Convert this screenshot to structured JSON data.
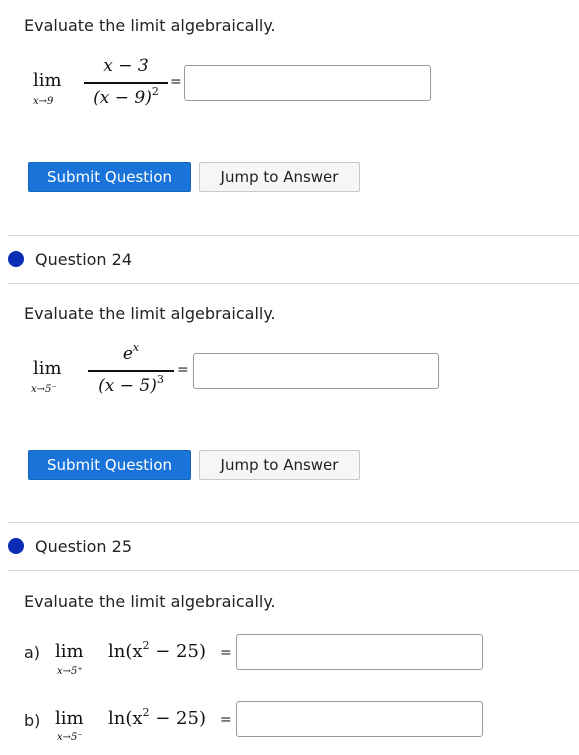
{
  "q23": {
    "prompt": "Evaluate the limit algebraically.",
    "lim": "lim",
    "sub": "x→9",
    "num": "x − 3",
    "den_base": "(x − 9)",
    "den_exp": "2",
    "equals": "=",
    "answer_value": "",
    "submit_label": "Submit Question",
    "jump_label": "Jump to Answer"
  },
  "q24": {
    "title": "Question 24",
    "prompt": "Evaluate the limit algebraically.",
    "lim": "lim",
    "sub": "x→5⁻",
    "num_base": "e",
    "num_exp": "x",
    "den_base": "(x − 5)",
    "den_exp": "3",
    "equals": "=",
    "answer_value": "",
    "submit_label": "Submit Question",
    "jump_label": "Jump to Answer"
  },
  "q25": {
    "title": "Question 25",
    "prompt": "Evaluate the limit algebraically.",
    "parts": [
      {
        "label": "a)",
        "lim": "lim",
        "sub": "x→5⁺",
        "expr": "ln(x",
        "exp": "2",
        "expr_tail": " − 25)",
        "equals": "=",
        "answer_value": ""
      },
      {
        "label": "b)",
        "lim": "lim",
        "sub": "x→5⁻",
        "expr": "ln(x",
        "exp": "2",
        "expr_tail": " − 25)",
        "equals": "=",
        "answer_value": ""
      }
    ]
  },
  "colors": {
    "accent": "#1a73d9",
    "status_dot": "#0a2db4"
  }
}
